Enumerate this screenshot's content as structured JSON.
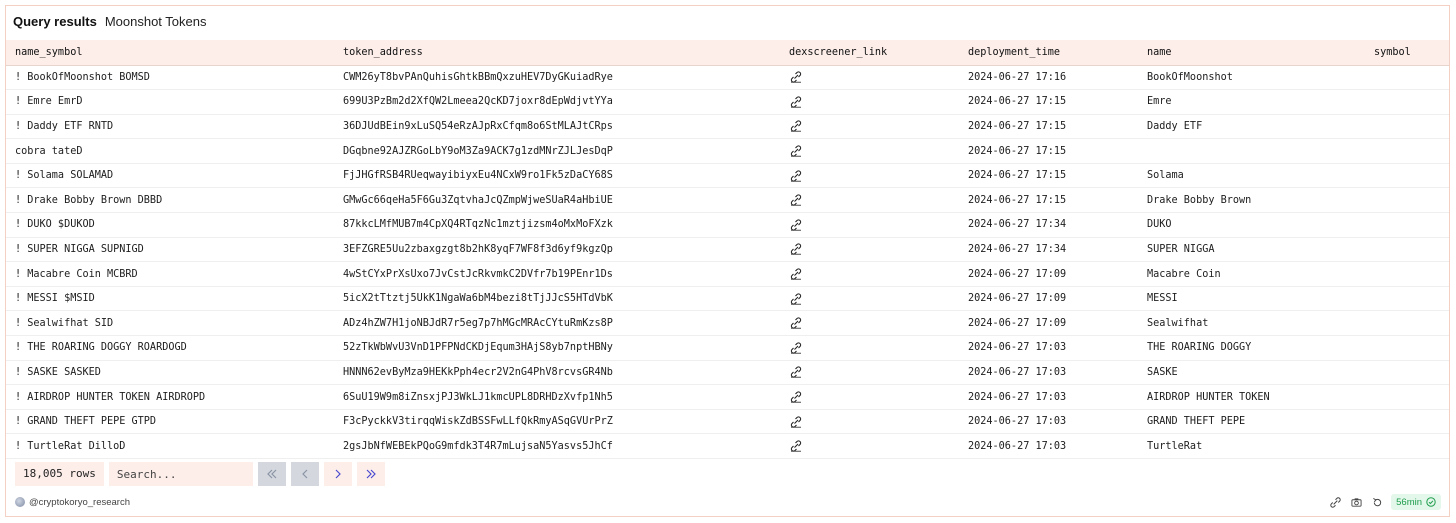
{
  "header": {
    "title": "Query results",
    "subtitle": "Moonshot Tokens"
  },
  "table": {
    "columns": [
      "name_symbol",
      "token_address",
      "dexscreener_link",
      "deployment_time",
      "name",
      "symbol"
    ],
    "rows": [
      {
        "name_symbol": "! BookOfMoonshot BOMSD",
        "token_address": "CWM26yT8bvPAnQuhisGhtkBBmQxzuHEV7DyGKuiadRye",
        "link_icon": "link-icon",
        "deployment_time": "2024-06-27 17:16",
        "name": "BookOfMoonshot",
        "symbol": ""
      },
      {
        "name_symbol": "! Emre EmrD",
        "token_address": "699U3PzBm2d2XfQW2Lmeea2QcKD7joxr8dEpWdjvtYYa",
        "link_icon": "link-icon",
        "deployment_time": "2024-06-27 17:15",
        "name": "Emre",
        "symbol": ""
      },
      {
        "name_symbol": "! Daddy ETF RNTD",
        "token_address": "36DJUdBEin9xLuSQ54eRzAJpRxCfqm8o6StMLAJtCRps",
        "link_icon": "link-icon",
        "deployment_time": "2024-06-27 17:15",
        "name": "Daddy ETF",
        "symbol": ""
      },
      {
        "name_symbol": "cobra tateD",
        "token_address": "DGqbne92AJZRGoLbY9oM3Za9ACK7g1zdMNrZJLJesDqP",
        "link_icon": "link-icon",
        "deployment_time": "2024-06-27 17:15",
        "name": "",
        "symbol": ""
      },
      {
        "name_symbol": "! Solama SOLAMAD",
        "token_address": "FjJHGfRSB4RUeqwayibiyxEu4NCxW9ro1Fk5zDaCY68S",
        "link_icon": "link-icon",
        "deployment_time": "2024-06-27 17:15",
        "name": "Solama",
        "symbol": ""
      },
      {
        "name_symbol": "! Drake Bobby Brown DBBD",
        "token_address": "GMwGc66qeHa5F6Gu3ZqtvhaJcQZmpWjweSUaR4aHbiUE",
        "link_icon": "link-icon",
        "deployment_time": "2024-06-27 17:15",
        "name": "Drake Bobby Brown",
        "symbol": ""
      },
      {
        "name_symbol": "! DUKO $DUKOD",
        "token_address": "87kkcLMfMUB7m4CpXQ4RTqzNc1mztjizsm4oMxMoFXzk",
        "link_icon": "link-icon",
        "deployment_time": "2024-06-27 17:34",
        "name": "DUKO",
        "symbol": ""
      },
      {
        "name_symbol": "! SUPER NIGGA SUPNIGD",
        "token_address": "3EFZGRE5Uu2zbaxgzgt8b2hK8yqF7WF8f3d6yf9kgzQp",
        "link_icon": "link-icon",
        "deployment_time": "2024-06-27 17:34",
        "name": "SUPER NIGGA",
        "symbol": ""
      },
      {
        "name_symbol": "! Macabre Coin MCBRD",
        "token_address": "4wStCYxPrXsUxo7JvCstJcRkvmkC2DVfr7b19PEnr1Ds",
        "link_icon": "link-icon",
        "deployment_time": "2024-06-27 17:09",
        "name": "Macabre Coin",
        "symbol": ""
      },
      {
        "name_symbol": "! MESSI $MSID",
        "token_address": "5icX2tTtztj5UkK1NgaWa6bM4bezi8tTjJJcS5HTdVbK",
        "link_icon": "link-icon",
        "deployment_time": "2024-06-27 17:09",
        "name": "MESSI",
        "symbol": ""
      },
      {
        "name_symbol": "! Sealwifhat  SID",
        "token_address": "ADz4hZW7H1joNBJdR7r5eg7p7hMGcMRAcCYtuRmKzs8P",
        "link_icon": "link-icon",
        "deployment_time": "2024-06-27 17:09",
        "name": "Sealwifhat",
        "symbol": ""
      },
      {
        "name_symbol": "! THE ROARING DOGGY ROARDOGD",
        "token_address": "52zTkWbWvU3VnD1PFPNdCKDjEqum3HAjS8yb7nptHBNy",
        "link_icon": "link-icon",
        "deployment_time": "2024-06-27 17:03",
        "name": "THE ROARING DOGGY",
        "symbol": ""
      },
      {
        "name_symbol": "! SASKE SASKED",
        "token_address": "HNNN62evByMza9HEKkPph4ecr2V2nG4PhV8rcvsGR4Nb",
        "link_icon": "link-icon",
        "deployment_time": "2024-06-27 17:03",
        "name": "SASKE",
        "symbol": ""
      },
      {
        "name_symbol": "! AIRDROP HUNTER TOKEN AIRDROPD",
        "token_address": "6SuU19W9m8iZnsxjPJ3WkLJ1kmcUPL8DRHDzXvfp1Nh5",
        "link_icon": "link-icon",
        "deployment_time": "2024-06-27 17:03",
        "name": "AIRDROP HUNTER TOKEN",
        "symbol": ""
      },
      {
        "name_symbol": "! GRAND THEFT PEPE GTPD",
        "token_address": "F3cPyckkV3tirqqWiskZdBSSFwLLfQkRmyASqGVUrPrZ",
        "link_icon": "link-icon",
        "deployment_time": "2024-06-27 17:03",
        "name": "GRAND THEFT PEPE",
        "symbol": ""
      },
      {
        "name_symbol": "! TurtleRat DilloD",
        "token_address": "2gsJbNfWEBEkPQoG9mfdk3T4R7mLujsaN5Yasvs5JhCf",
        "link_icon": "link-icon",
        "deployment_time": "2024-06-27 17:03",
        "name": "TurtleRat",
        "symbol": ""
      }
    ]
  },
  "footer": {
    "rows_count": "18,005 rows",
    "search_placeholder": "Search...",
    "pagination": {
      "first_icon": "double-chevron-left-icon",
      "prev_icon": "chevron-left-icon",
      "next_icon": "chevron-right-icon",
      "last_icon": "double-chevron-right-icon"
    },
    "credit": "@cryptokoryo_research",
    "timer": "56min",
    "tool_icons": [
      "embed-icon",
      "camera-icon",
      "refresh-icon",
      "check-circle-icon"
    ]
  },
  "colors": {
    "accent_bg": "#fdeeea",
    "border": "#f3cfc4",
    "pager_active": "#4b4bd0",
    "timer_text": "#1f9d4d"
  }
}
